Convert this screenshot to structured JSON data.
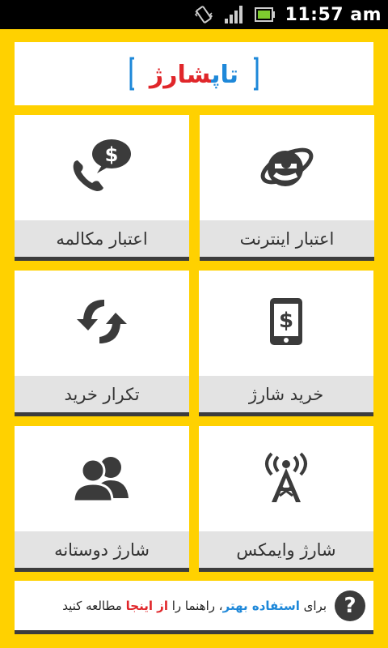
{
  "status_bar": {
    "time": "11:57 am",
    "icons": [
      "vibrate-icon",
      "signal-icon",
      "battery-icon"
    ]
  },
  "header": {
    "logo_text": "تاپ‌شارژ",
    "logo_colors": {
      "bracket": "#1e88d9",
      "text_blue": "#1e88d9",
      "text_red": "#e0262a"
    }
  },
  "tiles": [
    {
      "label": "اعتبار اینترنت",
      "icon": "internet-explorer-icon"
    },
    {
      "label": "اعتبار مکالمه",
      "icon": "phone-dollar-icon"
    },
    {
      "label": "خرید شارژ",
      "icon": "mobile-dollar-icon"
    },
    {
      "label": "تکرار خرید",
      "icon": "repeat-arrows-icon"
    },
    {
      "label": "شارژ وایمکس",
      "icon": "wimax-tower-icon"
    },
    {
      "label": "شارژ دوستانه",
      "icon": "users-icon"
    }
  ],
  "help": {
    "prefix": "برای",
    "highlight1": "استفاده بهتر",
    "middle": "، راهنما را",
    "highlight2": "از اینجا",
    "suffix": "مطالعه کنید",
    "icon_glyph": "?"
  },
  "colors": {
    "background": "#ffd100",
    "tile_label_bg": "#e3e3e3",
    "icon_color": "#3b3b3b"
  }
}
